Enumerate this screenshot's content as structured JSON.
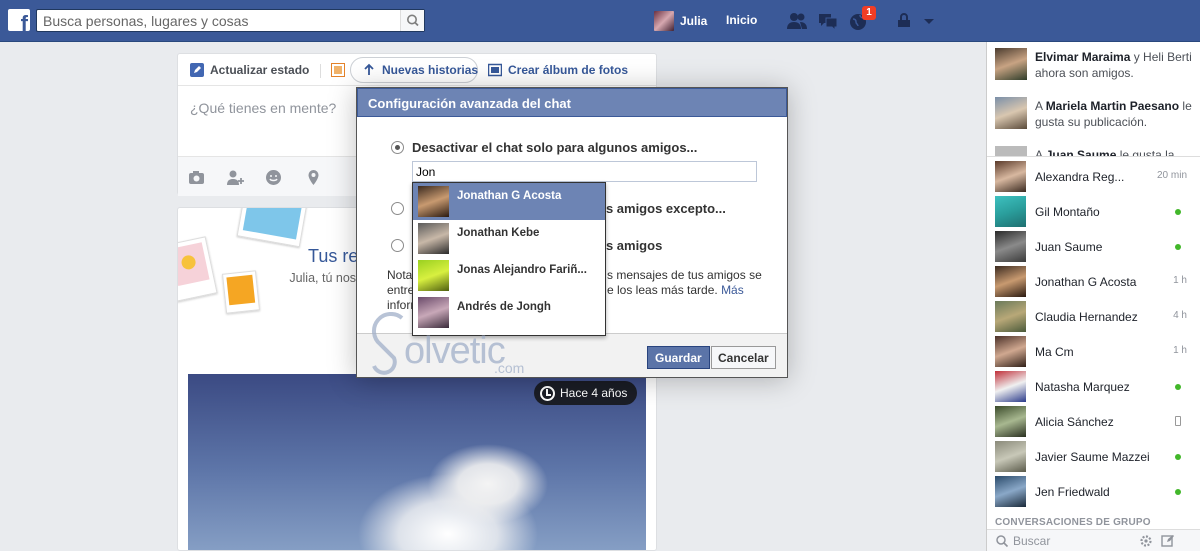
{
  "topbar": {
    "search_placeholder": "Busca personas, lugares y cosas",
    "user_name": "Julia",
    "home_label": "Inicio",
    "notifications_count": "1"
  },
  "composer": {
    "tab_status": "Actualizar estado",
    "tab_stories": "Nuevas historias",
    "tab_album": "Crear álbum de fotos",
    "placeholder": "¿Qué tienes en mente?"
  },
  "memories": {
    "title": "Tus re",
    "text": "Julia, tú nos ir que comparte rememorar c",
    "time_badge": "Hace 4 años"
  },
  "dialog": {
    "title": "Configuración avanzada del chat",
    "option1": "Desactivar el chat solo para algunos amigos...",
    "option2": "os amigos excepto...",
    "option3": "os amigos",
    "input_value": "Jon",
    "note_left": "Nota:\nentre\ninform",
    "note_right1": "s mensajes de tus amigos se",
    "note_right2": "e los leas más tarde.",
    "note_link": "Más",
    "save_label": "Guardar",
    "cancel_label": "Cancelar",
    "suggestions": [
      {
        "name": "Jonathan G Acosta",
        "selected": true
      },
      {
        "name": "Jonathan Kebe",
        "selected": false
      },
      {
        "name": "Jonas Alejandro Fariñ...",
        "selected": false
      },
      {
        "name": "Andrés de Jongh",
        "selected": false
      }
    ]
  },
  "watermark": {
    "text": "olvetic",
    "suffix": ".com"
  },
  "ticker": [
    {
      "name": "Elvimar Maraima",
      "rest": " y Heli Berti ahora son amigos."
    },
    {
      "pre": "A ",
      "name": "Mariela Martin Paesano",
      "rest": " le gusta su publicación."
    },
    {
      "pre": "A ",
      "name": "Juan Saume",
      "rest": " le gusta la"
    }
  ],
  "chat": {
    "contacts": [
      {
        "name": "Alexandra Reg...",
        "status": "20 min",
        "type": "time"
      },
      {
        "name": "Gil Montaño",
        "status": "",
        "type": "online"
      },
      {
        "name": "Juan Saume",
        "status": "",
        "type": "online"
      },
      {
        "name": "Jonathan G Acosta",
        "status": "1 h",
        "type": "time"
      },
      {
        "name": "Claudia Hernandez",
        "status": "4 h",
        "type": "time"
      },
      {
        "name": "Ma Cm",
        "status": "1 h",
        "type": "time"
      },
      {
        "name": "Natasha Marquez",
        "status": "",
        "type": "online"
      },
      {
        "name": "Alicia Sánchez",
        "status": "",
        "type": "mobile"
      },
      {
        "name": "Javier Saume Mazzei",
        "status": "",
        "type": "online"
      },
      {
        "name": "Jen Friedwald",
        "status": "",
        "type": "online"
      }
    ],
    "group_heading": "CONVERSACIONES DE GRUPO",
    "search_placeholder": "Buscar"
  },
  "colors": {
    "brand": "#3b5998",
    "dialog_header": "#6d84b4",
    "online": "#42b72a"
  }
}
